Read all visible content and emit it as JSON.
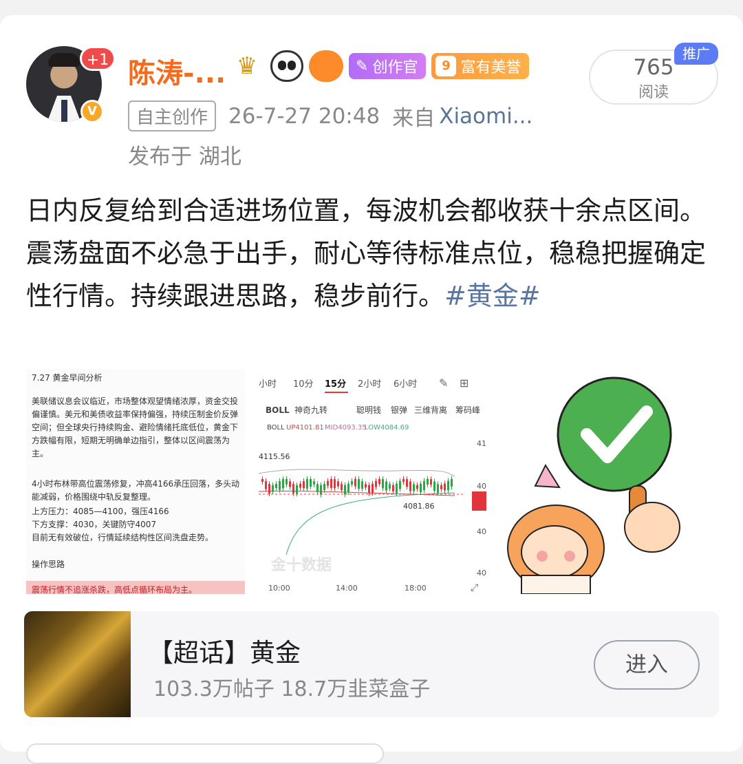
{
  "author": {
    "name": "陈涛-...",
    "notification_badge": "+1",
    "creator_tag": "创作官",
    "rich_tag_level": "9",
    "rich_tag": "富有美誉"
  },
  "meta": {
    "tag": "自主创作",
    "time": "26-7-27 20:48",
    "source_prefix": "来自",
    "source": "Xiaomi...",
    "location": "发布于 湖北"
  },
  "reads": {
    "count": "765",
    "label": "阅读",
    "promo": "推广"
  },
  "post": {
    "line1": "日内反复给到合适进场位置，每波机会都收获十余点区间。",
    "line2": "震荡盘面不必急于出手，耐心等待标准点位，稳稳把握确定性行情。持续跟进思路，稳步前行。",
    "hashtag": "#黄金#"
  },
  "image1": {
    "title": "7.27 黄金早间分析",
    "para1": "美联储议息会议临近，市场整体观望情绪浓厚，资金交投偏谨慎。美元和美债收益率保持偏强，持续压制金价反弹空间；但全球央行持续购金、避险情绪托底低位，黄金下方跌幅有限，短期无明确单边指引，整体以区间震荡为主。",
    "para2": "4小时布林带高位震荡修复，冲高4166承压回落，多头动能减弱，价格围绕中轨反复整理。",
    "resistance": "上方压力：4085—4100，强压4166",
    "support": "下方支撑：4030，关键防守4007",
    "para3": "目前无有效破位，行情延续结构性区间洗盘走势。",
    "op_title": "操作思路",
    "op_text": "震荡行情不追涨杀跌，高低点循环布局为主。"
  },
  "image2": {
    "tabs": [
      "小时",
      "10分",
      "15分",
      "2小时",
      "6小时"
    ],
    "indicators": [
      "BOLL",
      "神奇九转",
      "聪明钱",
      "银弹",
      "三维背离",
      "筹码峰"
    ],
    "boll_line": [
      "BOLL",
      "UP4101.81",
      "MID4093.35",
      "LOW4084.69"
    ],
    "high_label": "4115.56",
    "low_label": "4081.86",
    "watermark": "金十数据",
    "times": [
      "10:00",
      "14:00",
      "18:00"
    ],
    "axis": [
      "41",
      "40",
      "40",
      "40",
      "40"
    ]
  },
  "topic": {
    "title": "【超话】黄金",
    "stats": "103.3万帖子 18.7万韭菜盒子",
    "enter_label": "进入"
  },
  "colors": {
    "accent_orange": "#f36b1c",
    "link_blue": "#587599",
    "candle_up": "#e0353b",
    "candle_down": "#2aa745"
  }
}
